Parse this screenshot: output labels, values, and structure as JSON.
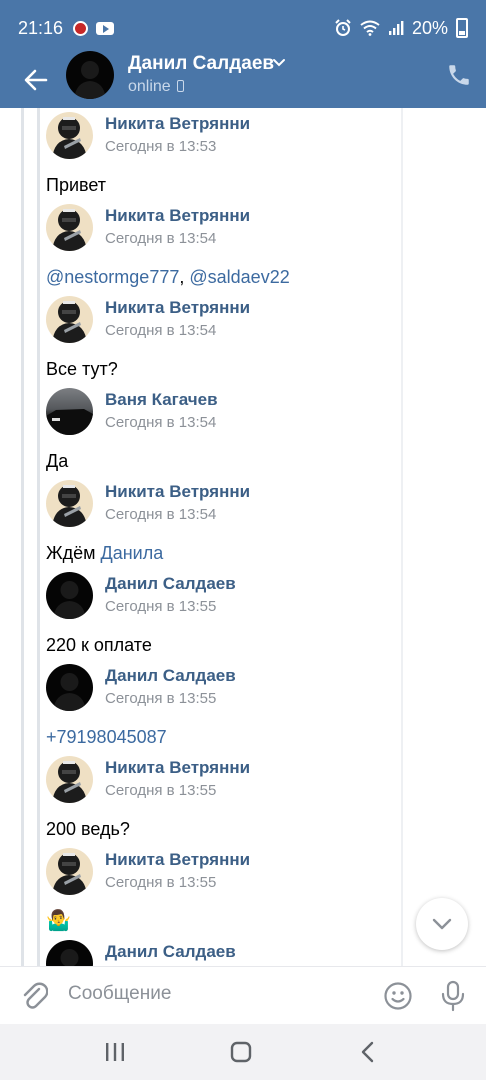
{
  "status_bar": {
    "time": "21:16",
    "battery": "20%",
    "icons": [
      "notification-dot-icon",
      "youtube-icon",
      "alarm-icon",
      "wifi-icon",
      "signal-icon",
      "battery-icon"
    ]
  },
  "header": {
    "title": "Данил Салдаев",
    "status": "online",
    "icons": [
      "back-arrow-icon",
      "chevron-down-icon",
      "mobile-device-icon",
      "phone-icon"
    ]
  },
  "messages": [
    {
      "author": "Никита Ветрянни",
      "time": "Сегодня в 13:53",
      "avatar": "beige-helmet",
      "text": "Привет"
    },
    {
      "author": "Никита Ветрянни",
      "time": "Сегодня в 13:54",
      "avatar": "beige-helmet",
      "mention1": "@nestormge777",
      "sep": ", ",
      "mention2": "@saldaev22"
    },
    {
      "author": "Никита Ветрянни",
      "time": "Сегодня в 13:54",
      "avatar": "beige-helmet",
      "text": "Все тут?"
    },
    {
      "author": "Ваня Кагачев",
      "time": "Сегодня в 13:54",
      "avatar": "car",
      "text": "Да"
    },
    {
      "author": "Никита Ветрянни",
      "time": "Сегодня в 13:54",
      "avatar": "beige-helmet",
      "text": "Ждём ",
      "link": "Данила"
    },
    {
      "author": "Данил Салдаев",
      "time": "Сегодня в 13:55",
      "avatar": "black-silhouette",
      "text": "220 к оплате"
    },
    {
      "author": "Данил Салдаев",
      "time": "Сегодня в 13:55",
      "avatar": "black-silhouette",
      "phone": "+79198045087"
    },
    {
      "author": "Никита Ветрянни",
      "time": "Сегодня в 13:55",
      "avatar": "beige-helmet",
      "text": "200 ведь?"
    },
    {
      "author": "Никита Ветрянни",
      "time": "Сегодня в 13:55",
      "avatar": "beige-helmet",
      "emoji": "🤷‍♂️"
    },
    {
      "author": "Данил Салдаев",
      "avatar": "black-silhouette"
    }
  ],
  "composer": {
    "placeholder": "Сообщение",
    "icons": [
      "attach-icon",
      "emoji-icon",
      "microphone-icon"
    ]
  },
  "colors": {
    "header_bg": "#4a76a8",
    "author_name": "#3c5f86",
    "link": "#3c6aa0",
    "timestamp": "#8c9198"
  }
}
